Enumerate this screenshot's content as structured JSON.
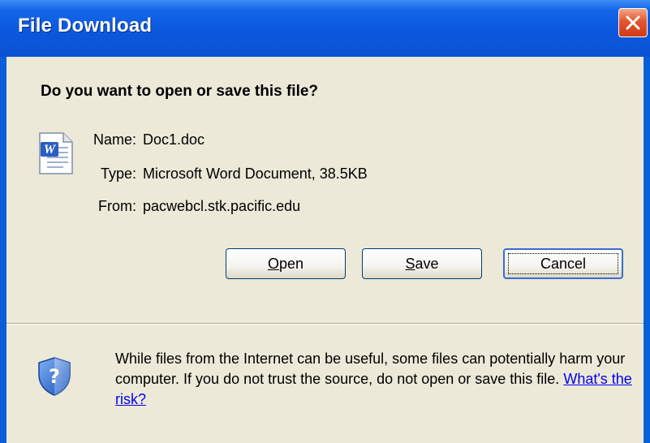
{
  "window": {
    "title": "File Download"
  },
  "dialog": {
    "heading": "Do you want to open or save this file?",
    "file": {
      "name_label": "Name:",
      "name_value": "Doc1.doc",
      "type_label": "Type:",
      "type_value": "Microsoft Word Document, 38.5KB",
      "from_label": "From:",
      "from_value": "pacwebcl.stk.pacific.edu"
    },
    "buttons": {
      "open": {
        "accel": "O",
        "rest": "pen"
      },
      "save": {
        "accel": "S",
        "rest": "ave"
      },
      "cancel": "Cancel"
    },
    "warning": {
      "text": "While files from the Internet can be useful, some files can potentially harm your computer. If you do not trust the source, do not open or save this file. ",
      "link": "What's the risk?"
    }
  },
  "icons": {
    "close": "close-icon",
    "file": "word-document-icon",
    "security": "shield-question-icon"
  },
  "colors": {
    "titlebar": "#0a5fd8",
    "close_button": "#e3552f",
    "dialog_background": "#ece9d8",
    "link": "#0000ee"
  }
}
